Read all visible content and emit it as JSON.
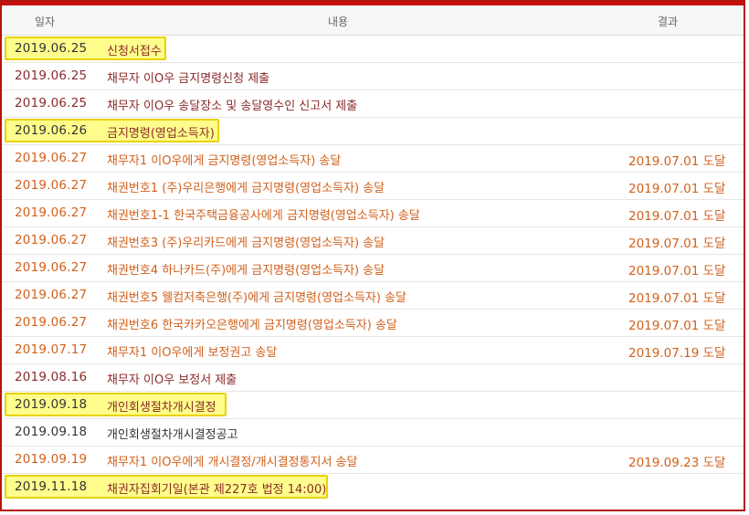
{
  "header": {
    "date_label": "일자",
    "content_label": "내용",
    "result_label": "결과"
  },
  "rows": [
    {
      "date": "2019.06.25",
      "content": "신청서접수",
      "result": ""
    },
    {
      "date": "2019.06.25",
      "content": "채무자 이O우 금지명령신청 제출",
      "result": ""
    },
    {
      "date": "2019.06.25",
      "content": "채무자 이O우 송달장소 및 송달영수인 신고서 제출",
      "result": ""
    },
    {
      "date": "2019.06.26",
      "content": "금지명령(영업소득자)",
      "result": ""
    },
    {
      "date": "2019.06.27",
      "content": "채무자1 이O우에게 금지명령(영업소득자) 송달",
      "result": "2019.07.01 도달"
    },
    {
      "date": "2019.06.27",
      "content": "채권번호1 (주)우리은행에게 금지명령(영업소득자) 송달",
      "result": "2019.07.01 도달"
    },
    {
      "date": "2019.06.27",
      "content": "채권번호1-1 한국주택금융공사에게 금지명령(영업소득자) 송달",
      "result": "2019.07.01 도달"
    },
    {
      "date": "2019.06.27",
      "content": "채권번호3 (주)우리카드에게 금지명령(영업소득자) 송달",
      "result": "2019.07.01 도달"
    },
    {
      "date": "2019.06.27",
      "content": "채권번호4 하나카드(주)에게 금지명령(영업소득자) 송달",
      "result": "2019.07.01 도달"
    },
    {
      "date": "2019.06.27",
      "content": "채권번호5 웰컴저축은행(주)에게 금지명령(영업소득자) 송달",
      "result": "2019.07.01 도달"
    },
    {
      "date": "2019.06.27",
      "content": "채권번호6 한국카카오은행에게 금지명령(영업소득자) 송달",
      "result": "2019.07.01 도달"
    },
    {
      "date": "2019.07.17",
      "content": "채무자1 이O우에게 보정권고 송달",
      "result": "2019.07.19 도달"
    },
    {
      "date": "2019.08.16",
      "content": "채무자 이O우 보정서 제출",
      "result": ""
    },
    {
      "date": "2019.09.18",
      "content": "개인회생절차개시결정",
      "result": ""
    },
    {
      "date": "2019.09.18",
      "content": "개인회생절차개시결정공고",
      "result": ""
    },
    {
      "date": "2019.09.19",
      "content": "채무자1 이O우에게 개시결정/개시결정통지서 송달",
      "result": "2019.09.23 도달"
    },
    {
      "date": "2019.11.18",
      "content": "채권자집회기일(본관 제227호 법정 14:00)",
      "result": ""
    }
  ],
  "colors": {
    "border": "#b5140b",
    "brown": "#8b2a2a",
    "orange": "#d2601a",
    "black": "#333333",
    "highlight": "#fffd8c"
  }
}
